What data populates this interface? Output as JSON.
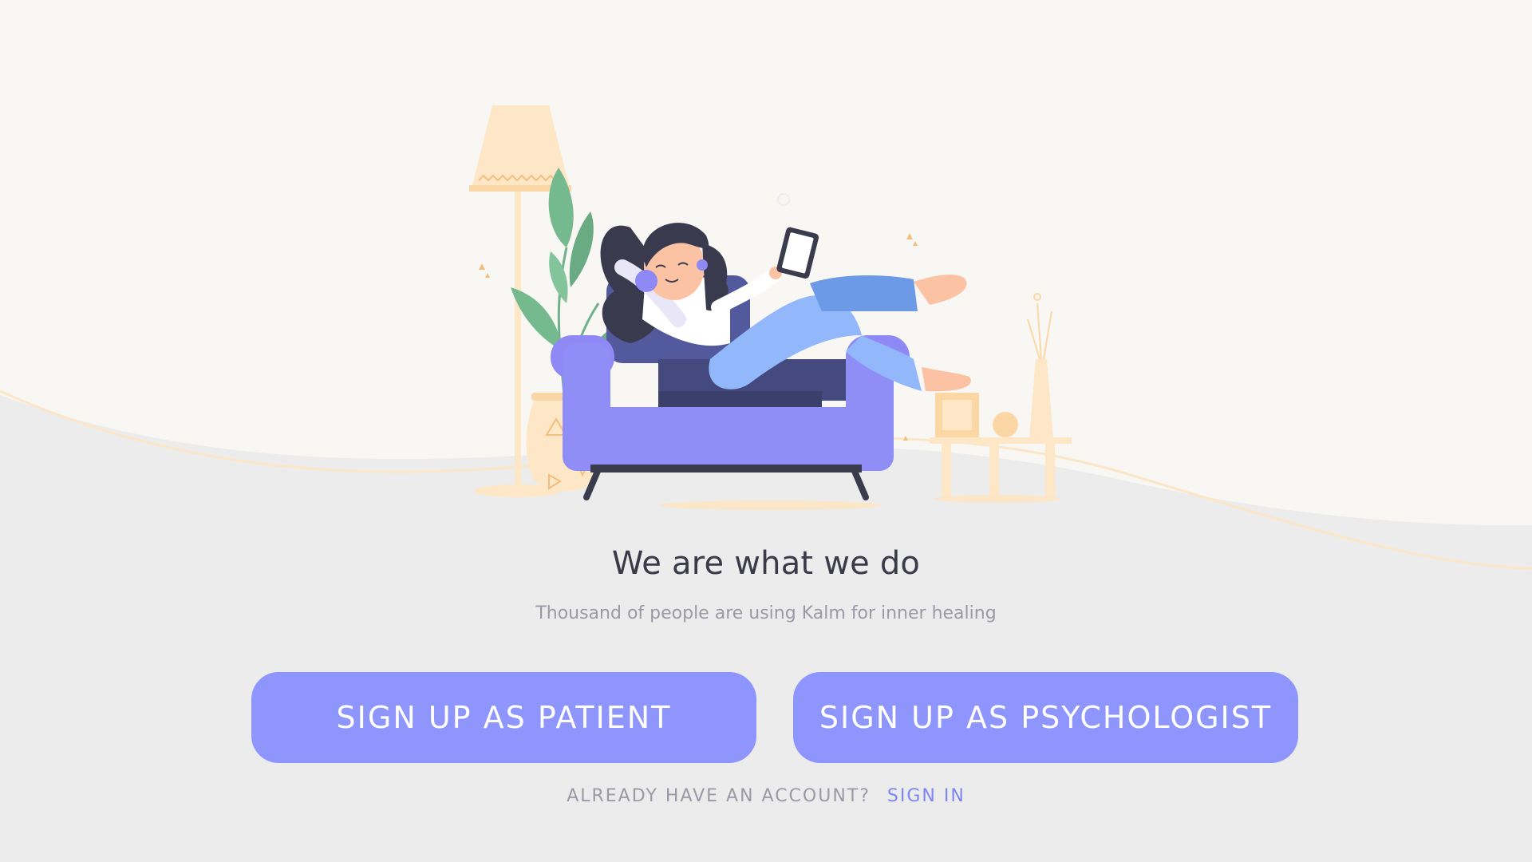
{
  "hero": {
    "headline": "We are what we do",
    "subline": "Thousand of people are using Kalm for inner healing"
  },
  "actions": {
    "patient_label": "SIGN UP AS PATIENT",
    "psychologist_label": "SIGN UP AS PSYCHOLOGIST"
  },
  "signin": {
    "question": "ALREADY HAVE AN ACCOUNT?",
    "link": "SIGN IN"
  },
  "colors": {
    "accent": "#8e95fd",
    "link": "#7d85f0",
    "background_top": "#f9f7f4",
    "background_bottom": "#ececec",
    "headline": "#3a3a48",
    "muted": "#9a9aa6"
  }
}
